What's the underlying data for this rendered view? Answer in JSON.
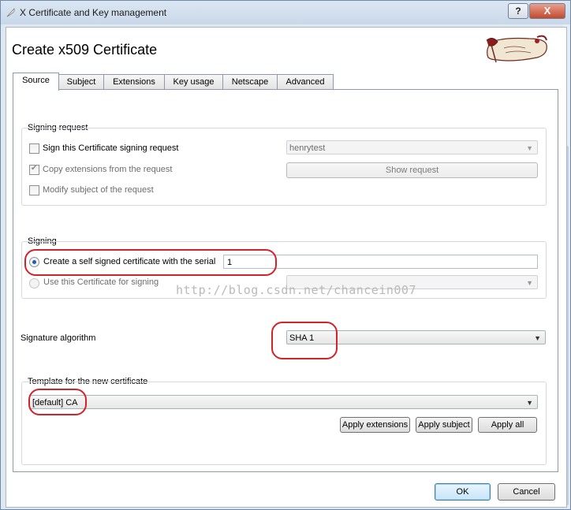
{
  "window": {
    "title": "X Certificate and Key management",
    "help_label": "?",
    "close_label": "X"
  },
  "header": {
    "title": "Create x509 Certificate"
  },
  "tabs": [
    {
      "label": "Source",
      "active": true
    },
    {
      "label": "Subject",
      "active": false
    },
    {
      "label": "Extensions",
      "active": false
    },
    {
      "label": "Key usage",
      "active": false
    },
    {
      "label": "Netscape",
      "active": false
    },
    {
      "label": "Advanced",
      "active": false
    }
  ],
  "signing_request": {
    "group_title": "Signing request",
    "sign_csr_label": "Sign this Certificate signing request",
    "sign_csr_checked": false,
    "csr_select_value": "henrytest",
    "copy_ext_label": "Copy extensions from the request",
    "copy_ext_checked": true,
    "show_request_label": "Show request",
    "modify_subject_label": "Modify subject of the request",
    "modify_subject_checked": false
  },
  "signing": {
    "group_title": "Signing",
    "self_signed_label": "Create a self signed certificate with the serial",
    "self_signed_selected": true,
    "serial_value": "1",
    "use_cert_label": "Use this Certificate for signing",
    "use_cert_value": ""
  },
  "signature": {
    "label": "Signature algorithm",
    "value": "SHA 1"
  },
  "template": {
    "group_title": "Template for the new certificate",
    "value": "[default] CA",
    "apply_extensions_label": "Apply extensions",
    "apply_subject_label": "Apply subject",
    "apply_all_label": "Apply all"
  },
  "footer": {
    "ok_label": "OK",
    "cancel_label": "Cancel"
  },
  "watermark": "http://blog.csdn.net/chancein007",
  "colors": {
    "annotation_red": "#d3232a",
    "radio_dot": "#1e5fb5"
  }
}
